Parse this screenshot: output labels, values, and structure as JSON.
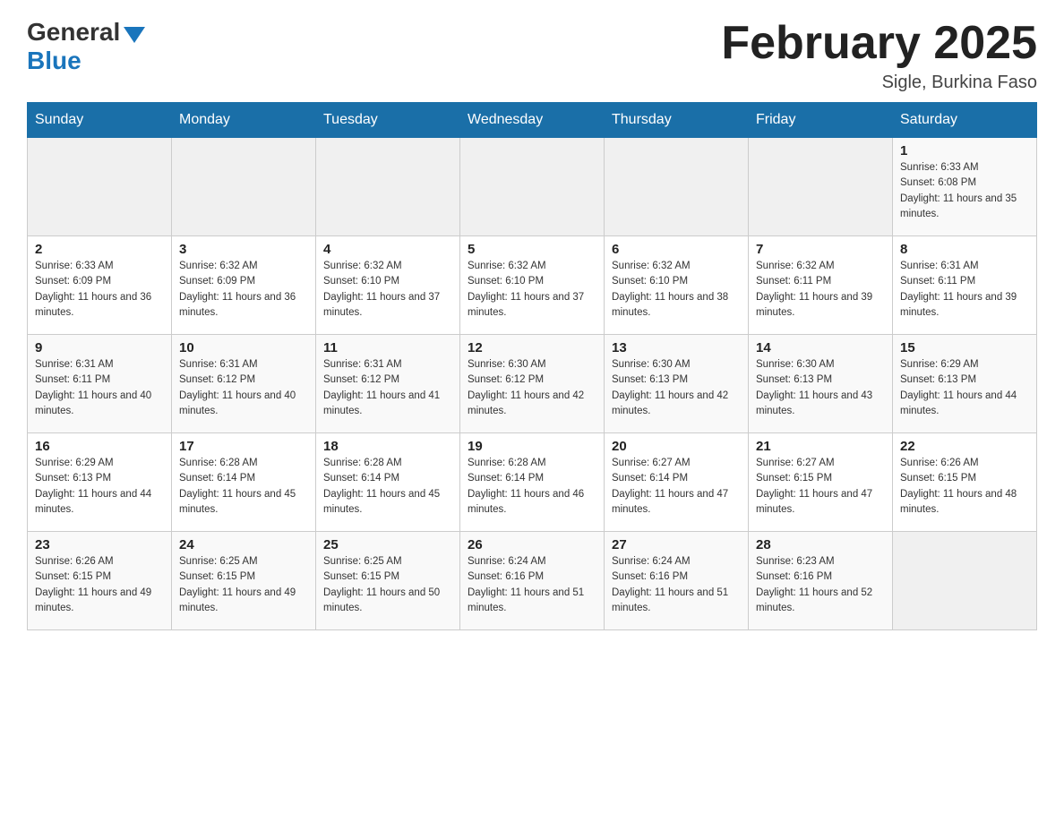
{
  "header": {
    "logo_general": "General",
    "logo_blue": "Blue",
    "month_title": "February 2025",
    "location": "Sigle, Burkina Faso"
  },
  "days_of_week": [
    "Sunday",
    "Monday",
    "Tuesday",
    "Wednesday",
    "Thursday",
    "Friday",
    "Saturday"
  ],
  "weeks": [
    [
      {
        "day": "",
        "info": ""
      },
      {
        "day": "",
        "info": ""
      },
      {
        "day": "",
        "info": ""
      },
      {
        "day": "",
        "info": ""
      },
      {
        "day": "",
        "info": ""
      },
      {
        "day": "",
        "info": ""
      },
      {
        "day": "1",
        "info": "Sunrise: 6:33 AM\nSunset: 6:08 PM\nDaylight: 11 hours and 35 minutes."
      }
    ],
    [
      {
        "day": "2",
        "info": "Sunrise: 6:33 AM\nSunset: 6:09 PM\nDaylight: 11 hours and 36 minutes."
      },
      {
        "day": "3",
        "info": "Sunrise: 6:32 AM\nSunset: 6:09 PM\nDaylight: 11 hours and 36 minutes."
      },
      {
        "day": "4",
        "info": "Sunrise: 6:32 AM\nSunset: 6:10 PM\nDaylight: 11 hours and 37 minutes."
      },
      {
        "day": "5",
        "info": "Sunrise: 6:32 AM\nSunset: 6:10 PM\nDaylight: 11 hours and 37 minutes."
      },
      {
        "day": "6",
        "info": "Sunrise: 6:32 AM\nSunset: 6:10 PM\nDaylight: 11 hours and 38 minutes."
      },
      {
        "day": "7",
        "info": "Sunrise: 6:32 AM\nSunset: 6:11 PM\nDaylight: 11 hours and 39 minutes."
      },
      {
        "day": "8",
        "info": "Sunrise: 6:31 AM\nSunset: 6:11 PM\nDaylight: 11 hours and 39 minutes."
      }
    ],
    [
      {
        "day": "9",
        "info": "Sunrise: 6:31 AM\nSunset: 6:11 PM\nDaylight: 11 hours and 40 minutes."
      },
      {
        "day": "10",
        "info": "Sunrise: 6:31 AM\nSunset: 6:12 PM\nDaylight: 11 hours and 40 minutes."
      },
      {
        "day": "11",
        "info": "Sunrise: 6:31 AM\nSunset: 6:12 PM\nDaylight: 11 hours and 41 minutes."
      },
      {
        "day": "12",
        "info": "Sunrise: 6:30 AM\nSunset: 6:12 PM\nDaylight: 11 hours and 42 minutes."
      },
      {
        "day": "13",
        "info": "Sunrise: 6:30 AM\nSunset: 6:13 PM\nDaylight: 11 hours and 42 minutes."
      },
      {
        "day": "14",
        "info": "Sunrise: 6:30 AM\nSunset: 6:13 PM\nDaylight: 11 hours and 43 minutes."
      },
      {
        "day": "15",
        "info": "Sunrise: 6:29 AM\nSunset: 6:13 PM\nDaylight: 11 hours and 44 minutes."
      }
    ],
    [
      {
        "day": "16",
        "info": "Sunrise: 6:29 AM\nSunset: 6:13 PM\nDaylight: 11 hours and 44 minutes."
      },
      {
        "day": "17",
        "info": "Sunrise: 6:28 AM\nSunset: 6:14 PM\nDaylight: 11 hours and 45 minutes."
      },
      {
        "day": "18",
        "info": "Sunrise: 6:28 AM\nSunset: 6:14 PM\nDaylight: 11 hours and 45 minutes."
      },
      {
        "day": "19",
        "info": "Sunrise: 6:28 AM\nSunset: 6:14 PM\nDaylight: 11 hours and 46 minutes."
      },
      {
        "day": "20",
        "info": "Sunrise: 6:27 AM\nSunset: 6:14 PM\nDaylight: 11 hours and 47 minutes."
      },
      {
        "day": "21",
        "info": "Sunrise: 6:27 AM\nSunset: 6:15 PM\nDaylight: 11 hours and 47 minutes."
      },
      {
        "day": "22",
        "info": "Sunrise: 6:26 AM\nSunset: 6:15 PM\nDaylight: 11 hours and 48 minutes."
      }
    ],
    [
      {
        "day": "23",
        "info": "Sunrise: 6:26 AM\nSunset: 6:15 PM\nDaylight: 11 hours and 49 minutes."
      },
      {
        "day": "24",
        "info": "Sunrise: 6:25 AM\nSunset: 6:15 PM\nDaylight: 11 hours and 49 minutes."
      },
      {
        "day": "25",
        "info": "Sunrise: 6:25 AM\nSunset: 6:15 PM\nDaylight: 11 hours and 50 minutes."
      },
      {
        "day": "26",
        "info": "Sunrise: 6:24 AM\nSunset: 6:16 PM\nDaylight: 11 hours and 51 minutes."
      },
      {
        "day": "27",
        "info": "Sunrise: 6:24 AM\nSunset: 6:16 PM\nDaylight: 11 hours and 51 minutes."
      },
      {
        "day": "28",
        "info": "Sunrise: 6:23 AM\nSunset: 6:16 PM\nDaylight: 11 hours and 52 minutes."
      },
      {
        "day": "",
        "info": ""
      }
    ]
  ]
}
